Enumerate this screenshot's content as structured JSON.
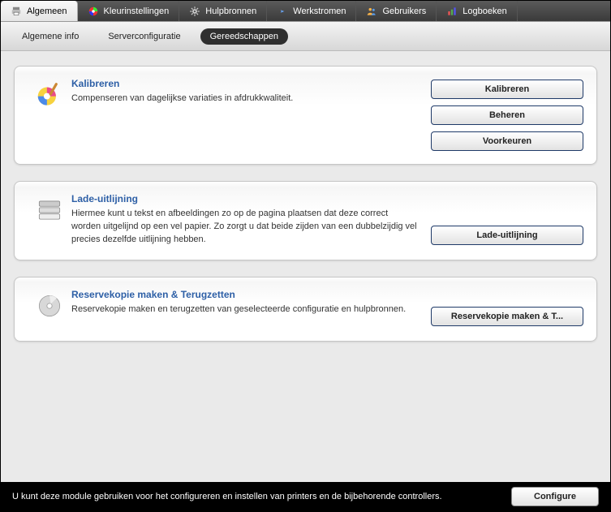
{
  "tabs": {
    "general": "Algemeen",
    "color": "Kleurinstellingen",
    "resources": "Hulpbronnen",
    "workflows": "Werkstromen",
    "users": "Gebruikers",
    "logs": "Logboeken"
  },
  "subtabs": {
    "info": "Algemene info",
    "server": "Serverconfiguratie",
    "tools": "Gereedschappen"
  },
  "panels": {
    "calibrate": {
      "title": "Kalibreren",
      "desc": "Compenseren van dagelijkse variaties in afdrukkwaliteit.",
      "btn_calibrate": "Kalibreren",
      "btn_manage": "Beheren",
      "btn_prefs": "Voorkeuren"
    },
    "tray": {
      "title": "Lade-uitlijning",
      "desc": "Hiermee kunt u tekst en afbeeldingen zo op de pagina plaatsen dat deze correct worden uitgelijnd op een vel papier. Zo zorgt u dat beide zijden van een dubbelzijdig vel precies dezelfde uitlijning hebben.",
      "btn": "Lade-uitlijning"
    },
    "backup": {
      "title": "Reservekopie maken & Terugzetten",
      "desc": "Reservekopie maken en terugzetten van geselecteerde configuratie en hulpbronnen.",
      "btn": "Reservekopie maken & T..."
    }
  },
  "footer": {
    "text": "U kunt deze module gebruiken voor het configureren en instellen van printers en de bijbehorende controllers.",
    "btn": "Configure"
  }
}
